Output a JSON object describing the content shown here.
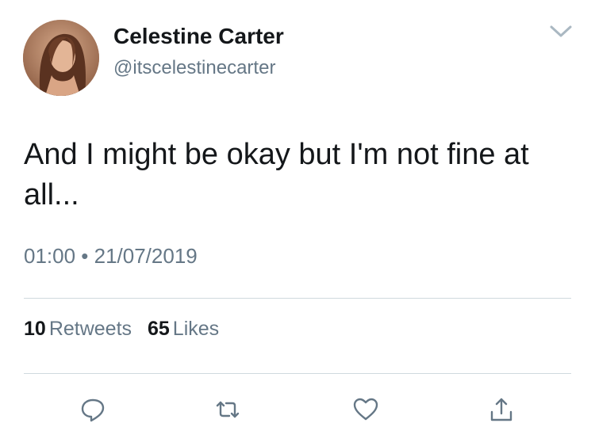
{
  "author": {
    "display_name": "Celestine Carter",
    "handle": "@itscelestinecarter"
  },
  "tweet": {
    "text": "And I might be okay but I'm not fine at all...",
    "timestamp": "01:00 • 21/07/2019"
  },
  "stats": {
    "retweets_count": "10",
    "retweets_label": "Retweets",
    "likes_count": "65",
    "likes_label": "Likes"
  },
  "icons": {
    "menu": "chevron-down-icon",
    "reply": "reply-icon",
    "retweet": "retweet-icon",
    "like": "heart-icon",
    "share": "share-icon"
  },
  "colors": {
    "text_primary": "#14171a",
    "text_secondary": "#657786",
    "divider": "#cfd9de",
    "icon": "#657786"
  }
}
